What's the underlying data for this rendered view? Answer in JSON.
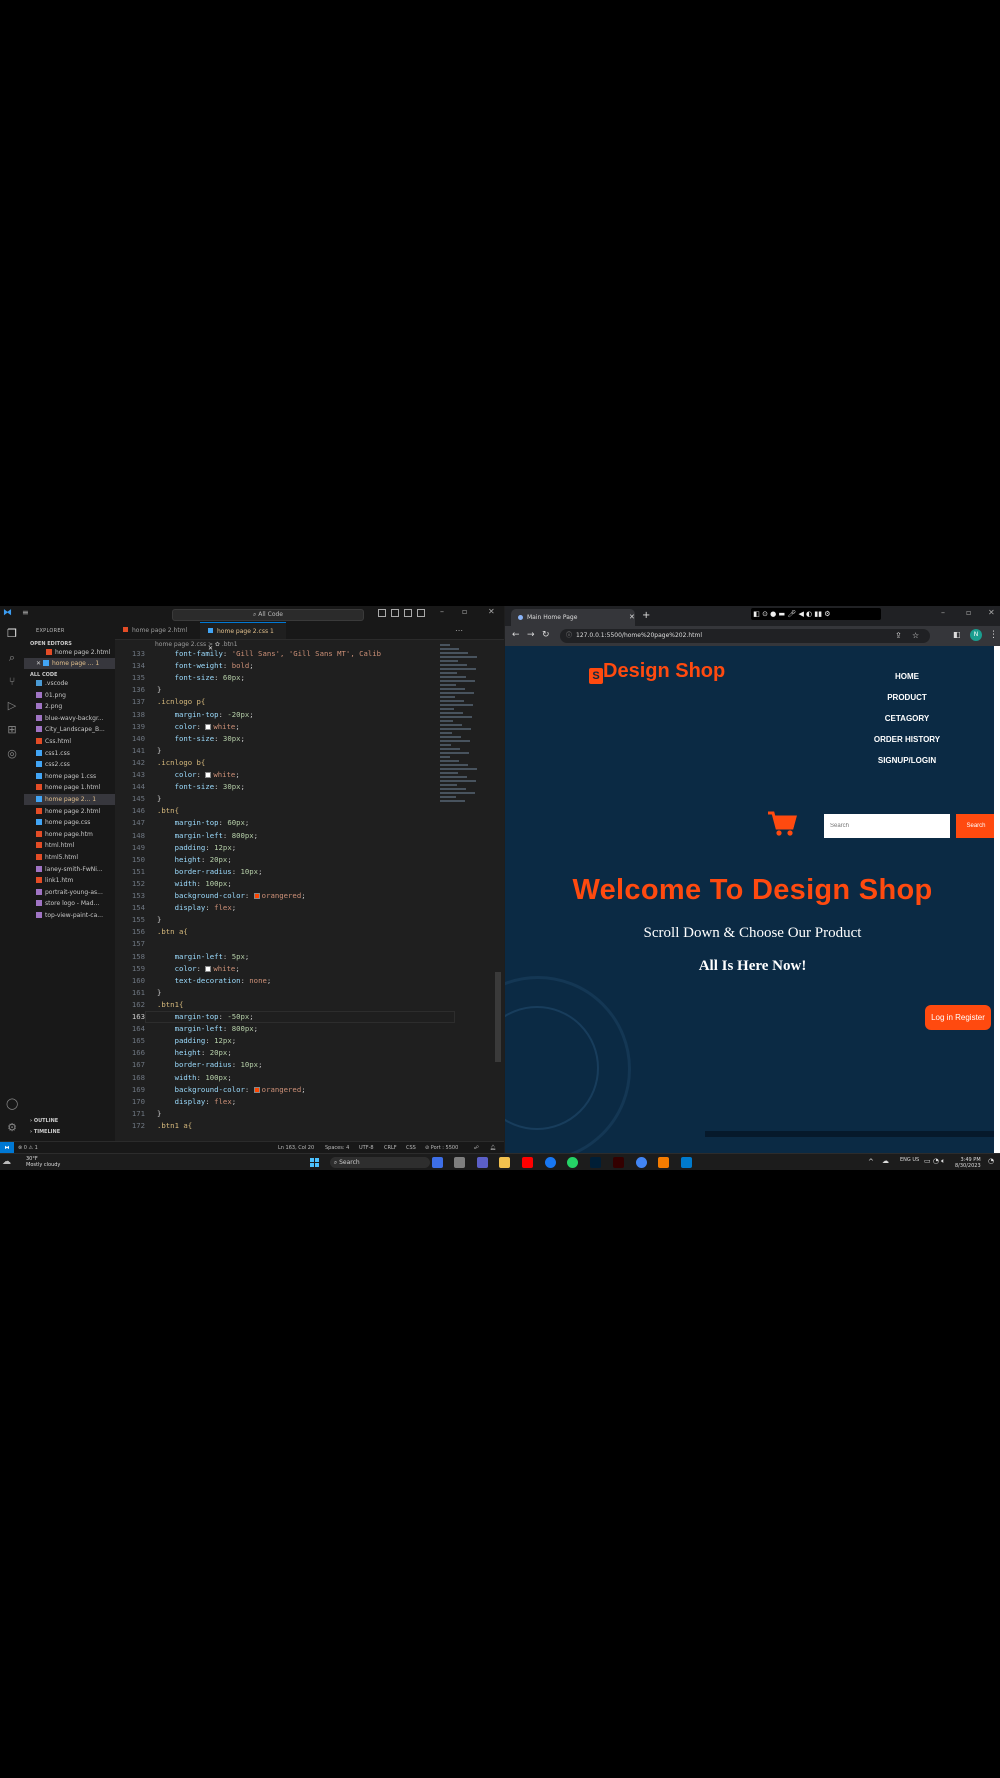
{
  "vscode": {
    "command_center": "All Code",
    "explorer_title": "EXPLORER",
    "open_editors_label": "OPEN EDITORS",
    "open_editors": [
      "home page 2.html",
      "home page ... 1"
    ],
    "folder_label": "ALL CODE",
    "files": [
      ".vscode",
      "01.png",
      "2.png",
      "blue-wavy-backgr...",
      "City_Landscape_B...",
      "Css.html",
      "css1.css",
      "css2.css",
      "home page 1.css",
      "home page 1.html",
      "home page 2...  1",
      "home page 2.html",
      "home page.css",
      "home page.htm",
      "html.html",
      "html5.html",
      "laney-smith-FwNi...",
      "link1.htm",
      "portrait-young-as...",
      "store logo - Mad...",
      "top-view-paint-ca..."
    ],
    "outline_label": "OUTLINE",
    "timeline_label": "TIMELINE",
    "tabs": [
      "home page 2.html",
      "home page 2.css 1"
    ],
    "breadcrumb": "home page 2.css > ✿ .btn1",
    "code_lines": [
      {
        "n": "133",
        "t": "    font-family: 'Gill Sans', 'Gill Sans MT', Calib"
      },
      {
        "n": "134",
        "t": "    font-weight: bold;"
      },
      {
        "n": "135",
        "t": "    font-size: 60px;"
      },
      {
        "n": "136",
        "t": "}"
      },
      {
        "n": "137",
        "t": ".icnlogo p{"
      },
      {
        "n": "138",
        "t": "    margin-top: -20px;"
      },
      {
        "n": "139",
        "t": "    color: ■white;"
      },
      {
        "n": "140",
        "t": "    font-size: 30px;"
      },
      {
        "n": "141",
        "t": "}"
      },
      {
        "n": "142",
        "t": ".icnlogo b{"
      },
      {
        "n": "143",
        "t": "    color: ■white;"
      },
      {
        "n": "144",
        "t": "    font-size: 30px;"
      },
      {
        "n": "145",
        "t": "}"
      },
      {
        "n": "146",
        "t": ".btn{"
      },
      {
        "n": "147",
        "t": "    margin-top: 60px;"
      },
      {
        "n": "148",
        "t": "    margin-left: 800px;"
      },
      {
        "n": "149",
        "t": "    padding: 12px;"
      },
      {
        "n": "150",
        "t": "    height: 20px;"
      },
      {
        "n": "151",
        "t": "    border-radius: 10px;"
      },
      {
        "n": "152",
        "t": "    width: 100px;"
      },
      {
        "n": "153",
        "t": "    background-color: ■orangered;"
      },
      {
        "n": "154",
        "t": "    display: flex;"
      },
      {
        "n": "155",
        "t": "}"
      },
      {
        "n": "156",
        "t": ".btn a{"
      },
      {
        "n": "157",
        "t": ""
      },
      {
        "n": "158",
        "t": "    margin-left: 5px;"
      },
      {
        "n": "159",
        "t": "    color: ■white;"
      },
      {
        "n": "160",
        "t": "    text-decoration: none;"
      },
      {
        "n": "161",
        "t": "}"
      },
      {
        "n": "162",
        "t": ".btn1{"
      },
      {
        "n": "163",
        "t": "    margin-top: -50px;"
      },
      {
        "n": "164",
        "t": "    margin-left: 800px;"
      },
      {
        "n": "165",
        "t": "    padding: 12px;"
      },
      {
        "n": "166",
        "t": "    height: 20px;"
      },
      {
        "n": "167",
        "t": "    border-radius: 10px;"
      },
      {
        "n": "168",
        "t": "    width: 100px;"
      },
      {
        "n": "169",
        "t": "    background-color: ■orangered;"
      },
      {
        "n": "170",
        "t": "    display: flex;"
      },
      {
        "n": "171",
        "t": "}"
      },
      {
        "n": "172",
        "t": ".btn1 a{"
      }
    ],
    "current_line": "163",
    "status": {
      "problems": "⊗ 0 ⚠ 1",
      "position": "Ln 163, Col 20",
      "spaces": "Spaces: 4",
      "encoding": "UTF-8",
      "eol": "CRLF",
      "lang": "CSS",
      "port": "⊘ Port : 5500"
    }
  },
  "browser": {
    "tab_title": "Main Home Page",
    "url": "127.0.0.1:5500/home%20page%202.html",
    "avatar_letter": "N",
    "page": {
      "brand": "Design Shop",
      "brand_icon": "S",
      "nav": [
        "HOME",
        "PRODUCT",
        "CETAGORY",
        "ORDER HISTORY",
        "SIGNUP/LOGIN"
      ],
      "search_placeholder": "Search",
      "search_button": "Search",
      "heading": "Welcome To Design Shop",
      "subheading": "Scroll Down & Choose Our Product",
      "tagline": "All Is Here Now!",
      "login_button": "Log in Register"
    },
    "accent_color": "#ff4a0f",
    "page_bg": "#0b2a44"
  },
  "taskbar": {
    "weather_temp": "30°F",
    "weather_desc": "Mostly cloudy",
    "search_label": "Search",
    "lang": "ENG US",
    "time": "3:49 PM",
    "date": "8/30/2023"
  }
}
